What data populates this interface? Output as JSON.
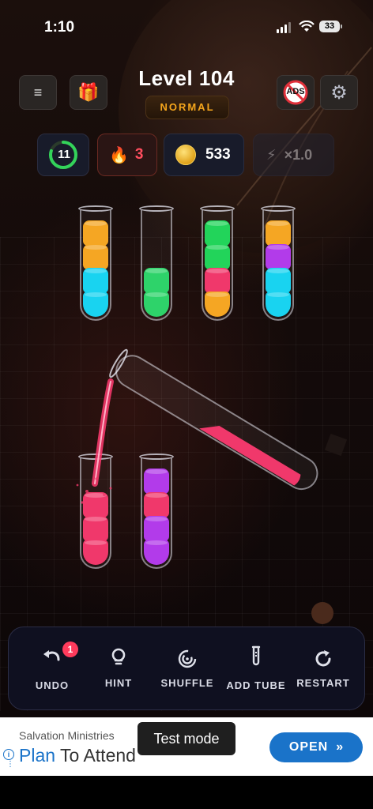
{
  "status_bar": {
    "time": "1:10",
    "battery": "33"
  },
  "header": {
    "menu_icon": "≡",
    "gift_icon": "🎁",
    "level_title": "Level 104",
    "difficulty": "NORMAL",
    "no_ads_label": "ADS",
    "settings_icon": "⚙"
  },
  "stats": {
    "moves_left": "11",
    "moves_progress": 0.8,
    "streak": "3",
    "coins": "533",
    "multiplier": "×1.0"
  },
  "tubes": [
    {
      "id": "tube-1",
      "layers": [
        "#f5a623",
        "#f5a623",
        "#19d3f0",
        "#19d3f0"
      ]
    },
    {
      "id": "tube-2",
      "layers": [
        "#2ed36a",
        "#2ed36a"
      ]
    },
    {
      "id": "tube-3",
      "layers": [
        "#22d45a",
        "#22d45a",
        "#f0386b",
        "#f5a623"
      ]
    },
    {
      "id": "tube-4",
      "layers": [
        "#f5a623",
        "#b23bea",
        "#19d3f0",
        "#19d3f0"
      ]
    },
    {
      "id": "tube-5",
      "layers": [
        "#f0386b",
        "#f0386b",
        "#f0386b"
      ]
    },
    {
      "id": "tube-6",
      "layers": [
        "#b23bea",
        "#f0386b",
        "#b23bea",
        "#b23bea"
      ]
    }
  ],
  "pouring_tube": {
    "color": "#f0386b"
  },
  "toolbar": {
    "undo_label": "UNDO",
    "undo_badge": "1",
    "hint_label": "HINT",
    "shuffle_label": "SHUFFLE",
    "add_tube_label": "ADD TUBE",
    "restart_label": "RESTART"
  },
  "ad": {
    "advertiser": "Salvation Ministries",
    "headline_strong": "Plan",
    "headline_rest": "To Attend",
    "cta": "OPEN",
    "test_mode": "Test mode"
  },
  "colors": {
    "accent_orange": "#f4a51c",
    "cta_blue": "#1a73c9",
    "streak_red": "#ff4d5e"
  }
}
